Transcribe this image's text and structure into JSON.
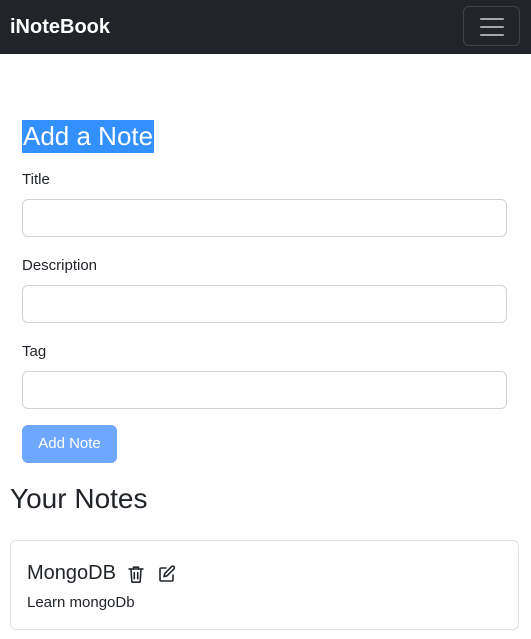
{
  "navbar": {
    "brand": "iNoteBook",
    "toggler_icon": "hamburger-menu-icon"
  },
  "form": {
    "heading": "Add a Note",
    "title_label": "Title",
    "title_value": "",
    "description_label": "Description",
    "description_value": "",
    "tag_label": "Tag",
    "tag_value": "",
    "submit_label": "Add Note"
  },
  "notes": {
    "heading": "Your Notes",
    "items": [
      {
        "title": "MongoDB",
        "description": "Learn mongoDb",
        "delete_icon": "trash-icon",
        "edit_icon": "edit-icon"
      }
    ]
  },
  "colors": {
    "navbar_bg": "#212529",
    "selection_highlight": "#3390ff",
    "button_bg": "#6ea8fe"
  }
}
